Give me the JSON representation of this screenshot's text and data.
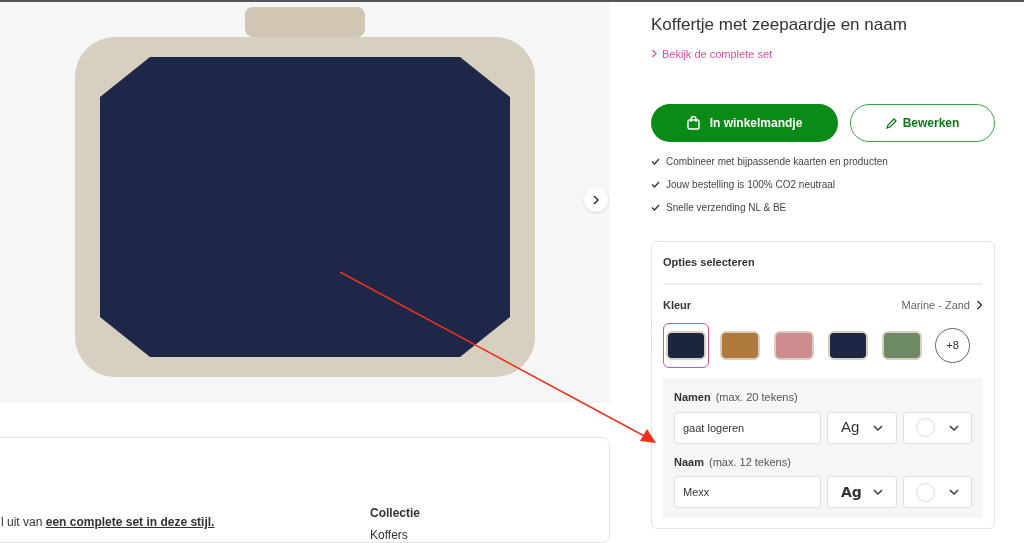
{
  "product": {
    "title": "Koffertje met zeepaardje en naam",
    "set_link": "Bekijk de complete set"
  },
  "actions": {
    "cart_button": "In winkelmandje",
    "edit_button": "Bewerken"
  },
  "usps": [
    "Combineer met bijpassende kaarten en producten",
    "Jouw bestelling is 100% CO2 neutraal",
    "Snelle verzending NL & BE"
  ],
  "options": {
    "heading": "Opties selecteren",
    "color_label": "Kleur",
    "color_value": "Marine - Zand",
    "swatches": [
      {
        "color": "#1c2540",
        "selected": true
      },
      {
        "color": "#b07a3c",
        "selected": false
      },
      {
        "color": "#cf8c8e",
        "selected": false
      },
      {
        "color": "#1d2744",
        "selected": false
      },
      {
        "color": "#6e8a65",
        "selected": false
      }
    ],
    "more_button": "+8",
    "fields": [
      {
        "label": "Namen",
        "hint": "(max. 20 tekens)",
        "value": "gaat logeren",
        "font_sample": "Ag",
        "kind": "regular"
      },
      {
        "label": "Naam",
        "hint": "(max. 12 tekens)",
        "value": "Mexx",
        "font_sample": "Ag",
        "kind": "display"
      }
    ]
  },
  "details": {
    "text_before": "l uit van ",
    "link": "een complete set in deze stijl.",
    "collection_label": "Collectie",
    "collection_value": "Koffers"
  }
}
